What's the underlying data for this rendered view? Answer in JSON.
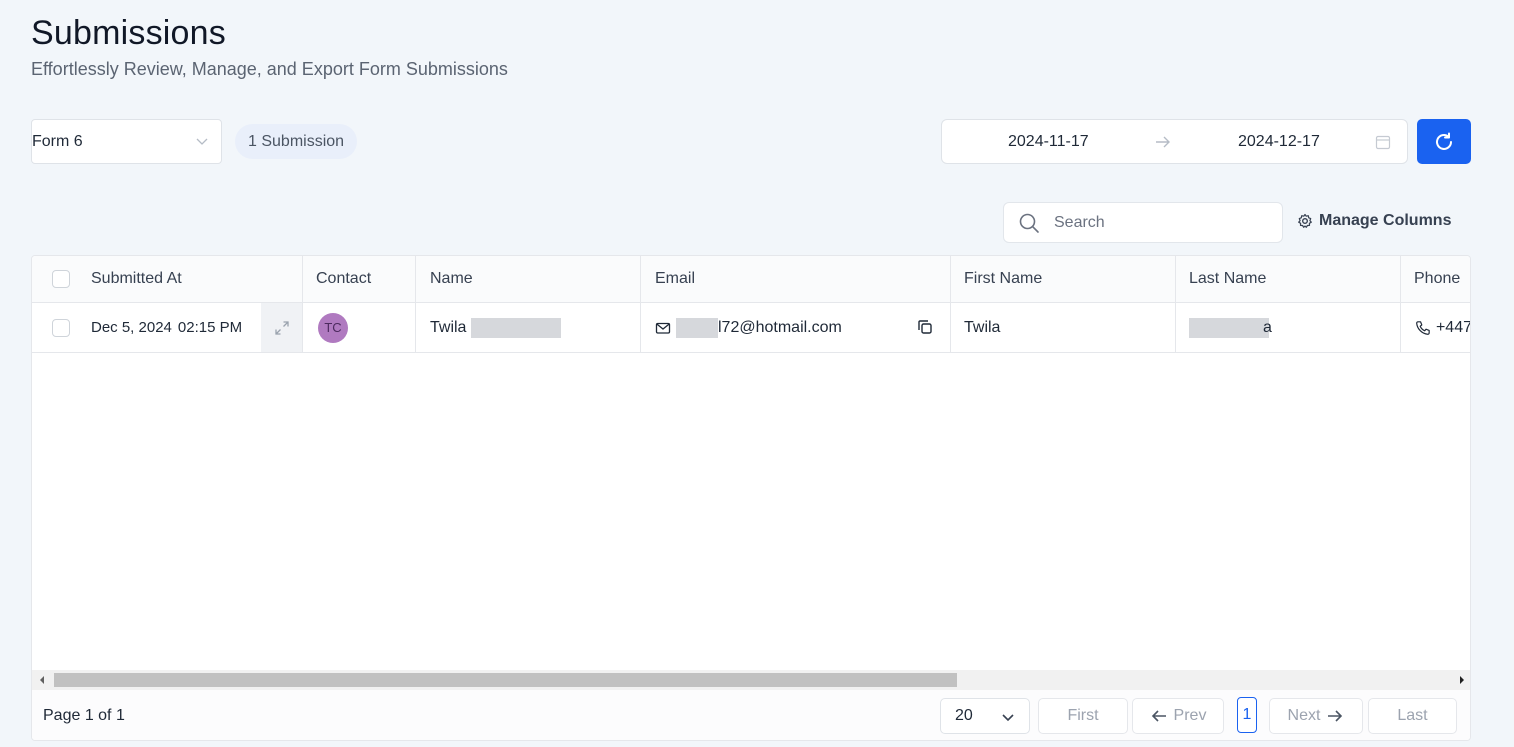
{
  "header": {
    "title": "Submissions",
    "subtitle": "Effortlessly Review, Manage, and Export Form Submissions"
  },
  "toolbar": {
    "form_selected": "Form 6",
    "submission_count": "1 Submission",
    "date_start": "2024-11-17",
    "date_end": "2024-12-17",
    "search_placeholder": "Search",
    "manage_columns_label": "Manage Columns"
  },
  "table": {
    "columns": [
      "Submitted At",
      "Contact",
      "Name",
      "Email",
      "First Name",
      "Last Name",
      "Phone"
    ],
    "rows": [
      {
        "submitted_date": "Dec 5, 2024",
        "submitted_time": "02:15 PM",
        "contact_initials": "TC",
        "name": "Twila",
        "email_visible": "l72@hotmail.com",
        "first_name": "Twila",
        "last_name_suffix": "a",
        "phone": "+447"
      }
    ]
  },
  "pagination": {
    "page_info": "Page 1 of 1",
    "per_page": "20",
    "first_label": "First",
    "prev_label": "Prev",
    "current_page": "1",
    "next_label": "Next",
    "last_label": "Last"
  },
  "colors": {
    "primary": "#1a62f0",
    "avatar_bg": "#b07ac0",
    "page_bg": "#f2f6fa"
  },
  "icons": [
    "chevron-down-icon",
    "arrow-right-icon",
    "calendar-icon",
    "refresh-icon",
    "search-icon",
    "gear-icon",
    "expand-icon",
    "mail-icon",
    "copy-icon",
    "phone-icon",
    "arrow-left-icon"
  ]
}
